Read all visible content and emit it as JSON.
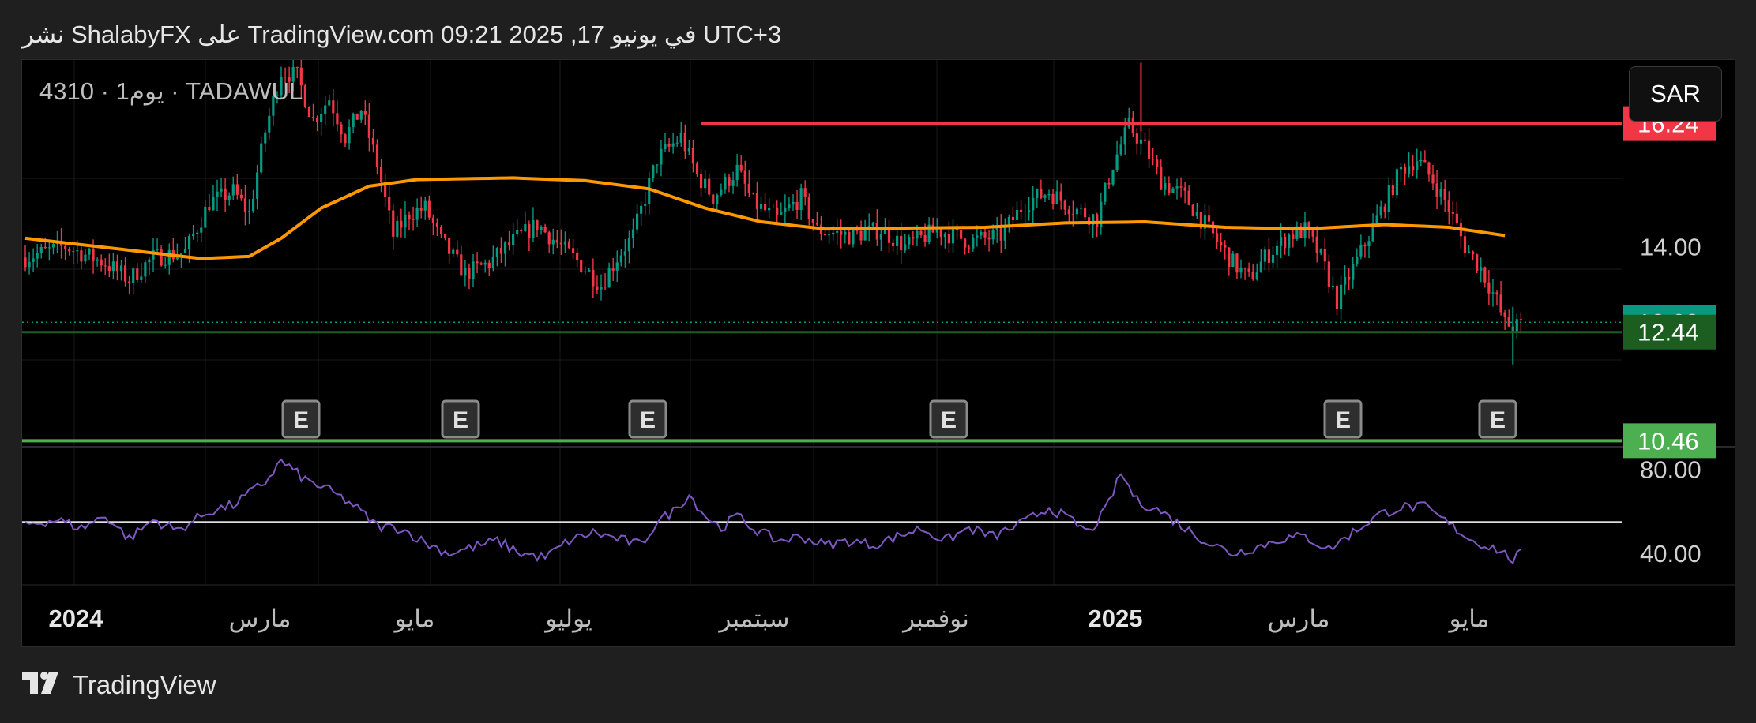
{
  "header": {
    "text": "نشر ShalabyFX على TradingView.com 09:21 2025 ,17 في يونيو UTC+3"
  },
  "symbol_label": "4310 · 1يوم · TADAWUL",
  "currency_button": "SAR",
  "footer": {
    "brand": "TradingView"
  },
  "colors": {
    "background": "#000000",
    "up_candle": "#089981",
    "down_candle": "#f23645",
    "ma_line": "#ff9800",
    "resistance_line": "#f23645",
    "support_line": "#4caf50",
    "rsi_line": "#7e57c2",
    "rsi_level": "#ffffff",
    "last_price_label": "#089981",
    "dark_green_label": "#1b5e20",
    "light_green_label": "#4caf50",
    "red_label": "#f23645"
  },
  "chart_data": {
    "type": "candlestick",
    "price_axis": {
      "ticks": [
        "14.00"
      ],
      "range": [
        10.35,
        17.4
      ]
    },
    "time_axis": {
      "labels": [
        "2024",
        "مارس",
        "مايو",
        "يوليو",
        "سبتمبر",
        "نوفمبر",
        "2025",
        "مارس",
        "مايو"
      ]
    },
    "price_labels": [
      {
        "value": 16.24,
        "text": "16.24",
        "color": "#f23645"
      },
      {
        "value": 12.62,
        "text": "12.62",
        "color": "#089981"
      },
      {
        "value": 12.44,
        "text": "12.44",
        "color": "#1b5e20"
      },
      {
        "value": 10.46,
        "text": "10.46",
        "color": "#4caf50"
      }
    ],
    "horizontal_lines": [
      {
        "name": "resistance",
        "value": 16.24,
        "color": "#f23645"
      },
      {
        "name": "support",
        "value": 10.46,
        "color": "#4caf50"
      },
      {
        "name": "level",
        "value": 12.44,
        "color": "#1b5e20"
      }
    ],
    "earnings_markers": [
      "E",
      "E",
      "E",
      "E",
      "E",
      "E"
    ],
    "price_waypoints": [
      [
        0,
        13.8
      ],
      [
        10,
        14.0
      ],
      [
        20,
        13.7
      ],
      [
        26,
        13.4
      ],
      [
        32,
        13.8
      ],
      [
        40,
        13.9
      ],
      [
        46,
        14.8
      ],
      [
        52,
        15.0
      ],
      [
        56,
        14.6
      ],
      [
        60,
        16.1
      ],
      [
        64,
        17.2
      ],
      [
        68,
        17.1
      ],
      [
        72,
        16.3
      ],
      [
        76,
        16.7
      ],
      [
        80,
        16.0
      ],
      [
        84,
        16.5
      ],
      [
        88,
        15.5
      ],
      [
        92,
        14.2
      ],
      [
        96,
        14.6
      ],
      [
        100,
        14.7
      ],
      [
        104,
        14.1
      ],
      [
        110,
        13.5
      ],
      [
        116,
        13.7
      ],
      [
        122,
        14.1
      ],
      [
        128,
        14.4
      ],
      [
        134,
        14.0
      ],
      [
        140,
        13.6
      ],
      [
        144,
        13.3
      ],
      [
        148,
        13.8
      ],
      [
        152,
        14.2
      ],
      [
        158,
        15.6
      ],
      [
        164,
        16.0
      ],
      [
        168,
        15.3
      ],
      [
        172,
        14.9
      ],
      [
        178,
        15.4
      ],
      [
        182,
        14.8
      ],
      [
        188,
        14.5
      ],
      [
        194,
        14.9
      ],
      [
        198,
        14.3
      ],
      [
        206,
        14.2
      ],
      [
        214,
        14.3
      ],
      [
        220,
        14.0
      ],
      [
        228,
        14.3
      ],
      [
        236,
        14.1
      ],
      [
        244,
        14.2
      ],
      [
        250,
        14.8
      ],
      [
        256,
        15.0
      ],
      [
        262,
        14.7
      ],
      [
        268,
        14.5
      ],
      [
        272,
        15.5
      ],
      [
        276,
        16.2
      ],
      [
        280,
        15.8
      ],
      [
        284,
        15.2
      ],
      [
        290,
        14.9
      ],
      [
        296,
        14.3
      ],
      [
        302,
        13.7
      ],
      [
        306,
        13.4
      ],
      [
        310,
        13.8
      ],
      [
        316,
        14.2
      ],
      [
        320,
        14.3
      ],
      [
        324,
        13.8
      ],
      [
        328,
        13.0
      ],
      [
        332,
        13.6
      ],
      [
        336,
        14.2
      ],
      [
        340,
        14.8
      ],
      [
        344,
        15.4
      ],
      [
        348,
        15.6
      ],
      [
        352,
        15.2
      ],
      [
        356,
        14.7
      ],
      [
        360,
        14.0
      ],
      [
        364,
        13.6
      ],
      [
        366,
        13.3
      ],
      [
        368,
        13.0
      ],
      [
        370,
        12.6
      ],
      [
        372,
        12.55
      ]
    ],
    "moving_average": {
      "color": "#ff9800",
      "points": [
        [
          0,
          14.15
        ],
        [
          24,
          13.95
        ],
        [
          44,
          13.78
        ],
        [
          56,
          13.82
        ],
        [
          64,
          14.15
        ],
        [
          74,
          14.7
        ],
        [
          86,
          15.1
        ],
        [
          98,
          15.22
        ],
        [
          122,
          15.25
        ],
        [
          140,
          15.2
        ],
        [
          156,
          15.05
        ],
        [
          170,
          14.7
        ],
        [
          184,
          14.45
        ],
        [
          200,
          14.32
        ],
        [
          240,
          14.35
        ],
        [
          260,
          14.43
        ],
        [
          280,
          14.45
        ],
        [
          300,
          14.35
        ],
        [
          320,
          14.32
        ],
        [
          340,
          14.4
        ],
        [
          356,
          14.35
        ],
        [
          370,
          14.2
        ]
      ]
    },
    "rsi": {
      "levels": [
        {
          "value": 80,
          "text": "80.00"
        },
        {
          "value": 40,
          "text": "40.00"
        }
      ],
      "midline": 55,
      "range": [
        25,
        87
      ],
      "waypoints": [
        [
          0,
          54
        ],
        [
          8,
          56
        ],
        [
          14,
          52
        ],
        [
          20,
          58
        ],
        [
          26,
          47
        ],
        [
          32,
          56
        ],
        [
          38,
          51
        ],
        [
          46,
          60
        ],
        [
          52,
          63
        ],
        [
          60,
          74
        ],
        [
          64,
          84
        ],
        [
          70,
          75
        ],
        [
          76,
          70
        ],
        [
          82,
          63
        ],
        [
          88,
          53
        ],
        [
          94,
          52
        ],
        [
          100,
          45
        ],
        [
          106,
          40
        ],
        [
          112,
          43
        ],
        [
          118,
          46
        ],
        [
          124,
          40
        ],
        [
          130,
          38
        ],
        [
          136,
          46
        ],
        [
          142,
          50
        ],
        [
          148,
          47
        ],
        [
          154,
          44
        ],
        [
          158,
          55
        ],
        [
          162,
          60
        ],
        [
          166,
          68
        ],
        [
          170,
          58
        ],
        [
          174,
          52
        ],
        [
          178,
          58
        ],
        [
          182,
          52
        ],
        [
          188,
          46
        ],
        [
          194,
          48
        ],
        [
          200,
          44
        ],
        [
          206,
          46
        ],
        [
          212,
          44
        ],
        [
          218,
          48
        ],
        [
          224,
          52
        ],
        [
          230,
          46
        ],
        [
          236,
          52
        ],
        [
          242,
          48
        ],
        [
          250,
          55
        ],
        [
          256,
          62
        ],
        [
          262,
          55
        ],
        [
          266,
          50
        ],
        [
          270,
          60
        ],
        [
          274,
          78
        ],
        [
          278,
          65
        ],
        [
          284,
          60
        ],
        [
          290,
          52
        ],
        [
          296,
          45
        ],
        [
          302,
          40
        ],
        [
          308,
          43
        ],
        [
          314,
          47
        ],
        [
          320,
          48
        ],
        [
          326,
          42
        ],
        [
          332,
          50
        ],
        [
          338,
          58
        ],
        [
          344,
          62
        ],
        [
          350,
          62
        ],
        [
          356,
          54
        ],
        [
          362,
          46
        ],
        [
          368,
          42
        ],
        [
          372,
          37
        ],
        [
          374,
          40
        ]
      ]
    }
  }
}
